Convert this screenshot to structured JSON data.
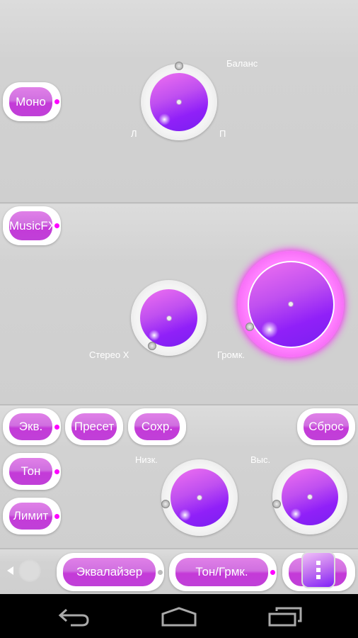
{
  "top": {
    "mono": "Моно",
    "balance": "Баланс",
    "left": "Л",
    "right": "П"
  },
  "middle": {
    "musicfx": "MusicFX",
    "stereo": "Стерео X",
    "volume": "Громк."
  },
  "eq": {
    "eq": "Экв.",
    "preset": "Пресет",
    "save": "Сохр.",
    "reset": "Сброс",
    "tone": "Тон",
    "limit": "Лимит",
    "bass": "Низк.",
    "treble": "Выс."
  },
  "bottom": {
    "equalizer": "Эквалайзер",
    "tone_volume": "Тон/Грмк.",
    "menu_icon": "more-vert-icon"
  },
  "colors": {
    "accent": "#ff00ff",
    "knob": "#9020f8"
  }
}
